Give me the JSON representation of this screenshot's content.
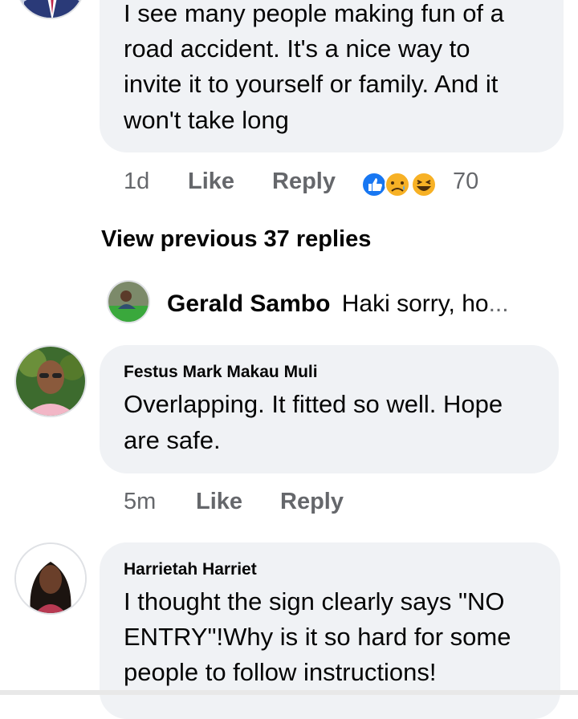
{
  "comment_top": {
    "text_lines": [
      "I see many people making fun of a",
      "road accident. It's a nice way to",
      "invite it to yourself or family. And it",
      "won't take long"
    ],
    "time": "1d",
    "like_label": "Like",
    "reply_label": "Reply",
    "reaction_count": "70",
    "reaction_icons": [
      "like-icon",
      "sad-icon",
      "haha-icon"
    ]
  },
  "view_previous": "View previous 37 replies",
  "reply_preview": {
    "author": "Gerald Sambo",
    "snippet": "Haki sorry, ho",
    "ellipsis": "..."
  },
  "comment_festus": {
    "author": "Festus Mark Makau Muli",
    "text_lines": [
      "Overlapping. It fitted so well. Hope",
      "are safe."
    ],
    "time": "5m",
    "like_label": "Like",
    "reply_label": "Reply"
  },
  "comment_harriet": {
    "author": "Harrietah Harriet",
    "text_lines": [
      "I thought the sign clearly says \"NO",
      "ENTRY\"!Why is it so hard for some",
      "people to follow instructions!"
    ]
  },
  "colors": {
    "bubble": "#f0f2f5",
    "meta_text": "#65676b",
    "like_blue": "#1877f2",
    "emoji_yellow": "#f7b125"
  }
}
